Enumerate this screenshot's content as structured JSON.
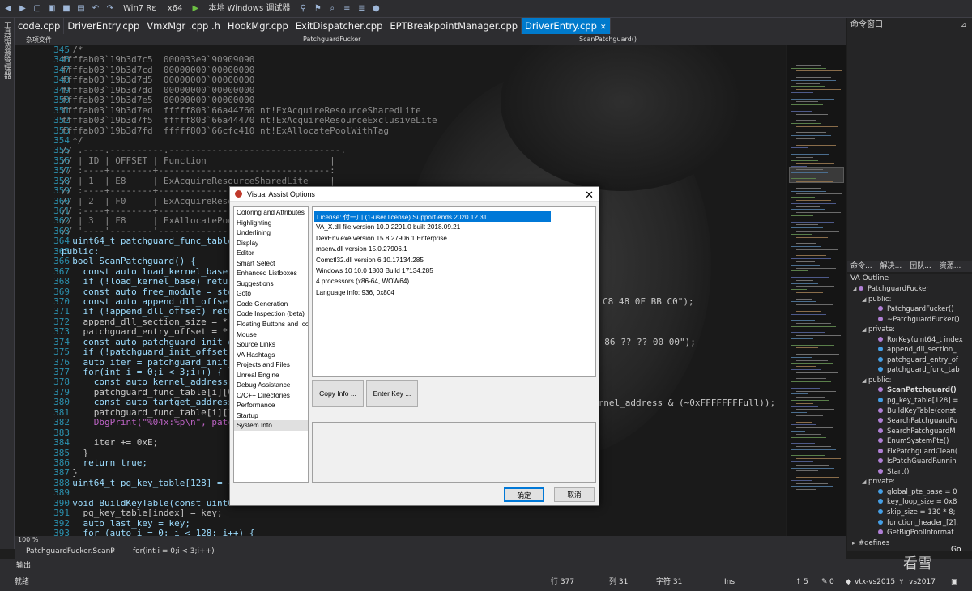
{
  "toolbar": {
    "platform_combo": "Win7 Rε",
    "arch_combo": "x64",
    "debugger_label": "本地 Windows 调试器"
  },
  "left_strip": {
    "items": [
      "工具箱",
      "资源管理器"
    ]
  },
  "tabs": [
    {
      "label": "code.cpp"
    },
    {
      "label": "DriverEntry.cpp"
    },
    {
      "label": "VmxMgr .cpp .h"
    },
    {
      "label": "HookMgr.cpp"
    },
    {
      "label": "ExitDispatcher.cpp"
    },
    {
      "label": "EPTBreakpointManager.cpp"
    },
    {
      "label": "DriverEntry.cpp",
      "active": true
    }
  ],
  "navbar": {
    "misc_files": "杂项文件",
    "class_combo": "PatchguardFucker",
    "function_combo": "ScanPatchguard()"
  },
  "editor": {
    "line_numbers": [
      "345",
      "346",
      "347",
      "348",
      "349",
      "350",
      "351",
      "352",
      "353",
      "354",
      "355",
      "356",
      "357",
      "358",
      "359",
      "360",
      "361",
      "362",
      "363",
      "364",
      "365",
      "366",
      "367",
      "368",
      "369",
      "370",
      "371",
      "372",
      "373",
      "374",
      "375",
      "376",
      "377",
      "378",
      "379",
      "380",
      "381",
      "382",
      "383",
      "384",
      "385",
      "386",
      "387",
      "388",
      "389",
      "390",
      "391",
      "392",
      "393"
    ],
    "lines": [
      "  /*",
      "ffffab03`19b3d7c5  000033e9`90909090",
      "ffffab03`19b3d7cd  00000000`00000000",
      "ffffab03`19b3d7d5  00000000`00000000",
      "ffffab03`19b3d7dd  00000000`00000000",
      "ffffab03`19b3d7e5  00000000`00000000",
      "ffffab03`19b3d7ed  fffff803`66a44760 nt!ExAcquireResourceSharedLite",
      "ffffab03`19b3d7f5  fffff803`66a44470 nt!ExAcquireResourceExclusiveLite",
      "ffffab03`19b3d7fd  fffff803`66cfc410 nt!ExAllocatePoolWithTag",
      "  */",
      "// .----.----------.--------------------------------.",
      "// | ID | OFFSET | Function                       |",
      "// :----+--------+--------------------------------:",
      "// | 1  | E8     | ExAcquireResourceSharedLite    |",
      "// :----+--------+--------------------------------:",
      "// | 2  | F0     | ExAcquireResourceExclusiveLite |",
      "// :----+--------+--------------------------------:",
      "// | 3  | F8     | ExAllocatePoolWithTag          |",
      "// '----'--------'--------------------------------'",
      "  uint64_t patchguard_func_table[3];",
      "public:",
      "  bool ScanPatchguard() {",
      "    const auto load_kernel_base = ",
      "    if (!load_kernel_base) return",
      "    const auto free_module = std",
      "    const auto append_dll_offset",
      "    if (!append_dll_offset) retur",
      "    append_dll_section_size = *(u",
      "    patchguard_entry_offset = *(u",
      "    const auto patchguard_init_o",
      "    if (!patchguard_init_offset)",
      "    auto iter = patchguard_init_",
      "    for(int i = 0;i < 3;i++) {",
      "      const auto kernel_address =",
      "      patchguard_func_table[i][0]",
      "      const auto tartget_address",
      "      patchguard_func_table[i][1]",
      "      DbgPrint(\"%04x:%p\\n\", patch",
      "",
      "      iter += 0xE;",
      "    }",
      "    return true;",
      "  }",
      "  uint64_t pg_key_table[128] = {",
      "",
      "  void BuildKeyTable(const uint64",
      "    pg_key_table[index] = key;",
      "    auto last_key = key;",
      "    for (auto i = 0; i < 128; i++) {"
    ],
    "right_fragments": {
      "f1": "C8 48 0F BB C0\");",
      "f2": "9 86 ?? ?? 00 00\");",
      "f3": "ernel_address & (~0xFFFFFFFFull));"
    }
  },
  "editor_footer": {
    "zoom": "100 %",
    "scope_combo": "PatchguardFucker.ScanP",
    "loop_combo": "for(int i = 0;i < 3;i++)",
    "output_label": "输出"
  },
  "command_window": {
    "title": "命令窗口"
  },
  "solution_tabs": [
    "命令...",
    "解决...",
    "团队...",
    "资源..."
  ],
  "va_outline": {
    "title": "VA Outline",
    "items": [
      {
        "label": "PatchguardFucker",
        "indent": 0,
        "kind": "class",
        "arrow": "open"
      },
      {
        "label": "public:",
        "indent": 1,
        "kind": "section",
        "arrow": "open"
      },
      {
        "label": "PatchguardFucker()",
        "indent": 2,
        "kind": "method"
      },
      {
        "label": "~PatchguardFucker()",
        "indent": 2,
        "kind": "method"
      },
      {
        "label": "private:",
        "indent": 1,
        "kind": "section",
        "arrow": "open"
      },
      {
        "label": "RorKey(uint64_t index",
        "indent": 2,
        "kind": "method"
      },
      {
        "label": "append_dll_section_",
        "indent": 2,
        "kind": "field"
      },
      {
        "label": "patchguard_entry_of",
        "indent": 2,
        "kind": "field"
      },
      {
        "label": "patchguard_func_tab",
        "indent": 2,
        "kind": "field"
      },
      {
        "label": "public:",
        "indent": 1,
        "kind": "section",
        "arrow": "open"
      },
      {
        "label": "ScanPatchguard()",
        "indent": 2,
        "kind": "method",
        "bold": true
      },
      {
        "label": "pg_key_table[128] =",
        "indent": 2,
        "kind": "field"
      },
      {
        "label": "BuildKeyTable(const",
        "indent": 2,
        "kind": "method"
      },
      {
        "label": "SearchPatchguardFu",
        "indent": 2,
        "kind": "method"
      },
      {
        "label": "SearchPatchguardM",
        "indent": 2,
        "kind": "method"
      },
      {
        "label": "EnumSystemPte()",
        "indent": 2,
        "kind": "method"
      },
      {
        "label": "FixPatchguardClean(",
        "indent": 2,
        "kind": "method"
      },
      {
        "label": "IsPatchGuardRunnin",
        "indent": 2,
        "kind": "method"
      },
      {
        "label": "Start()",
        "indent": 2,
        "kind": "method"
      },
      {
        "label": "private:",
        "indent": 1,
        "kind": "section",
        "arrow": "open"
      },
      {
        "label": "global_pte_base = 0",
        "indent": 2,
        "kind": "field"
      },
      {
        "label": "key_loop_size = 0x8",
        "indent": 2,
        "kind": "field"
      },
      {
        "label": "skip_size = 130 * 8;",
        "indent": 2,
        "kind": "field"
      },
      {
        "label": "function_header_[2],",
        "indent": 2,
        "kind": "field"
      },
      {
        "label": "GetBigPoolInformat",
        "indent": 2,
        "kind": "method"
      },
      {
        "label": "#defines",
        "indent": 0,
        "kind": "section",
        "arrow": "closed"
      }
    ],
    "go_button": "Go"
  },
  "statusbar": {
    "ready": "就绪",
    "line": "行 377",
    "col": "列 31",
    "char": "字符 31",
    "ins": "Ins",
    "up_count": "5",
    "err_count": "0",
    "repo": "vtx-vs2015",
    "branch": "vs2017",
    "watermark": "看雪"
  },
  "dialog": {
    "title": "Visual Assist Options",
    "close_glyph": "✕",
    "nav": [
      "Coloring and Attributes",
      "Highlighting",
      "Underlining",
      "Display",
      "Editor",
      "Smart Select",
      "Enhanced Listboxes",
      "Suggestions",
      "Goto",
      "Code Generation",
      "Code Inspection (beta)",
      "Floating Buttons and Icons",
      "Mouse",
      "Source Links",
      "VA Hashtags",
      "Projects and Files",
      "Unreal Engine",
      "Debug Assistance",
      "C/C++ Directories",
      "Performance",
      "Startup",
      "System Info"
    ],
    "selected_nav": "System Info",
    "info": [
      "License: 付一川 (1-user license) Support ends 2020.12.31",
      "VA_X.dll file version 10.9.2291.0  built 2018.09.21",
      "DevEnv.exe version 15.8.27906.1 Enterprise",
      "msenv.dll version 15.0.27906.1",
      "Comctl32.dll version 6.10.17134.285",
      "Windows 10 10.0 1803 Build 17134.285",
      "4 processors (x86-64, WOW64)",
      "Language info: 936, 0x804"
    ],
    "copy_button": "Copy Info ...",
    "enter_key_button": "Enter Key ...",
    "ok_button": "确定",
    "cancel_button": "取消"
  },
  "colors": {
    "accent": "#007acc",
    "selection": "#0078d7"
  }
}
